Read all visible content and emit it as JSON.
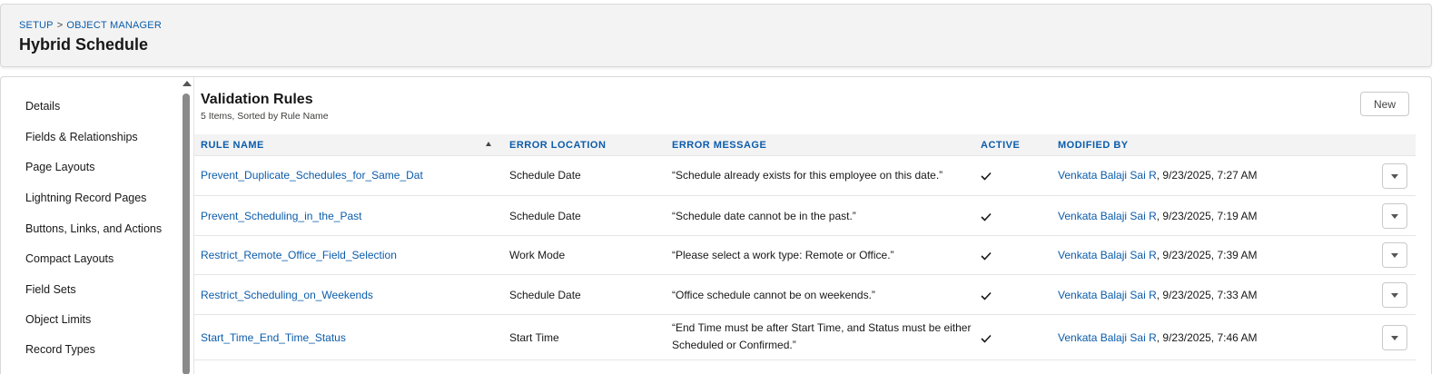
{
  "header": {
    "breadcrumb": [
      "SETUP",
      "OBJECT MANAGER"
    ],
    "breadcrumb_sep": ">",
    "title": "Hybrid Schedule"
  },
  "sidebar": {
    "items": [
      {
        "label": "Details"
      },
      {
        "label": "Fields & Relationships"
      },
      {
        "label": "Page Layouts"
      },
      {
        "label": "Lightning Record Pages"
      },
      {
        "label": "Buttons, Links, and Actions"
      },
      {
        "label": "Compact Layouts"
      },
      {
        "label": "Field Sets"
      },
      {
        "label": "Object Limits"
      },
      {
        "label": "Record Types"
      }
    ]
  },
  "main": {
    "title": "Validation Rules",
    "subtitle": "5 Items, Sorted by Rule Name",
    "new_label": "New",
    "columns": {
      "rule_name": "RULE NAME",
      "error_location": "ERROR LOCATION",
      "error_message": "ERROR MESSAGE",
      "active": "ACTIVE",
      "modified_by": "MODIFIED BY"
    },
    "rows": [
      {
        "rule_name": "Prevent_Duplicate_Schedules_for_Same_Dat",
        "error_location": "Schedule Date",
        "error_message": "“Schedule already exists for this employee on this date.”",
        "active": true,
        "modified_by": "Venkata Balaji Sai R",
        "modified_at": ", 9/23/2025, 7:27 AM"
      },
      {
        "rule_name": "Prevent_Scheduling_in_the_Past",
        "error_location": "Schedule Date",
        "error_message": "“Schedule date cannot be in the past.”",
        "active": true,
        "modified_by": "Venkata Balaji Sai R",
        "modified_at": ", 9/23/2025, 7:19 AM"
      },
      {
        "rule_name": "Restrict_Remote_Office_Field_Selection",
        "error_location": "Work Mode",
        "error_message": "“Please select a work type: Remote or Office.”",
        "active": true,
        "modified_by": "Venkata Balaji Sai R",
        "modified_at": ", 9/23/2025, 7:39 AM"
      },
      {
        "rule_name": "Restrict_Scheduling_on_Weekends",
        "error_location": "Schedule Date",
        "error_message": "“Office schedule cannot be on weekends.”",
        "active": true,
        "modified_by": "Venkata Balaji Sai R",
        "modified_at": ", 9/23/2025, 7:33 AM"
      },
      {
        "rule_name": "Start_Time_End_Time_Status",
        "error_location": "Start Time",
        "error_message": "“End Time must be after Start Time, and Status must be either Scheduled or Confirmed.”",
        "active": true,
        "modified_by": "Venkata Balaji Sai R",
        "modified_at": ", 9/23/2025, 7:46 AM"
      }
    ]
  },
  "colors": {
    "link": "#0b5cab",
    "header_bg": "#f3f3f3",
    "border": "#d8d8d8"
  },
  "icons": {
    "sort": "triangle-up-icon",
    "active": "check-icon",
    "row_menu": "chevron-down-icon"
  }
}
